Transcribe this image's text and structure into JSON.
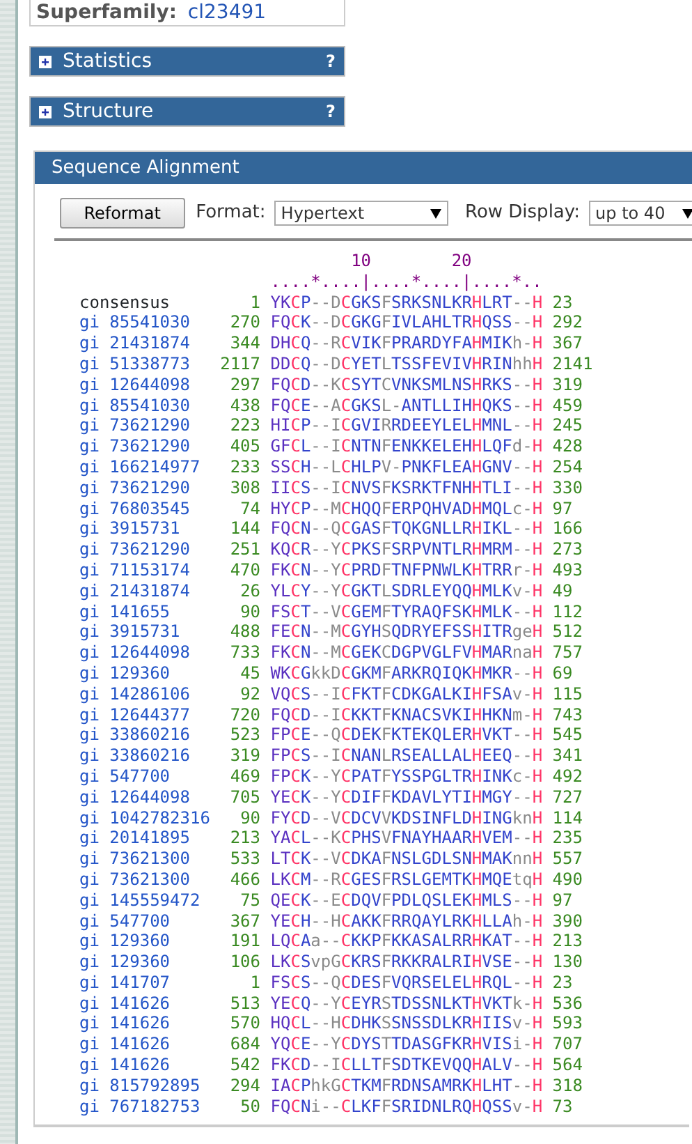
{
  "superfamily": {
    "label": "Superfamily:",
    "value": "cl23491"
  },
  "sections": [
    {
      "title": "Statistics",
      "expanded": false,
      "help": "?"
    },
    {
      "title": "Structure",
      "expanded": false,
      "help": "?"
    }
  ],
  "alignment_panel": {
    "title": "Sequence Alignment",
    "reformat_button": "Reformat",
    "format": {
      "label": "Format:",
      "value": "Hypertext"
    },
    "row_display": {
      "label": "Row Display:",
      "value": "up to 40"
    },
    "ruler": {
      "ticks": [
        "10",
        "20"
      ],
      "scale": "....*....|....*....|....*.."
    },
    "rows": [
      {
        "kind": "consensus",
        "name": "consensus",
        "start": "1",
        "sequence": "YKCP--DCGKSFSRKSNLKRHLRT--H",
        "end": "23"
      },
      {
        "kind": "hit",
        "name": "gi 85541030",
        "start": "270",
        "sequence": "FQCK--DCGKGFIVLAHLTRHQSS--H",
        "end": "292"
      },
      {
        "kind": "hit",
        "name": "gi 21431874",
        "start": "344",
        "sequence": "DHCQ--RCVIKFPRARDYFAHMIKh-H",
        "end": "367"
      },
      {
        "kind": "hit",
        "name": "gi 51338773",
        "start": "2117",
        "sequence": "DDCQ--DCYETLTSSFEVIVHRINhhH",
        "end": "2141"
      },
      {
        "kind": "hit",
        "name": "gi 12644098",
        "start": "297",
        "sequence": "FQCD--KCSYTCVNKSMLNSHRKS--H",
        "end": "319"
      },
      {
        "kind": "hit",
        "name": "gi 85541030",
        "start": "438",
        "sequence": "FQCE--ACGKSL-ANTLLIHHQKS--H",
        "end": "459"
      },
      {
        "kind": "hit",
        "name": "gi 73621290",
        "start": "223",
        "sequence": "HICP--ICGVIRRDEEYLELHMNL--H",
        "end": "245"
      },
      {
        "kind": "hit",
        "name": "gi 73621290",
        "start": "405",
        "sequence": "GFCL--ICNTNFENKKELEHHLQFd-H",
        "end": "428"
      },
      {
        "kind": "hit",
        "name": "gi 166214977",
        "start": "233",
        "sequence": "SSCH--LCHLPV-PNKFLEAHGNV--H",
        "end": "254"
      },
      {
        "kind": "hit",
        "name": "gi 73621290",
        "start": "308",
        "sequence": "IICS--ICNVSFKSRKTFNHHTLI--H",
        "end": "330"
      },
      {
        "kind": "hit",
        "name": "gi 76803545",
        "start": "74",
        "sequence": "HYCP--MCHQQFERPQHVADHMQLc-H",
        "end": "97"
      },
      {
        "kind": "hit",
        "name": "gi 3915731",
        "start": "144",
        "sequence": "FQCN--QCGASFTQKGNLLRHIKL--H",
        "end": "166"
      },
      {
        "kind": "hit",
        "name": "gi 73621290",
        "start": "251",
        "sequence": "KQCR--YCPKSFSRPVNTLRHMRM--H",
        "end": "273"
      },
      {
        "kind": "hit",
        "name": "gi 71153174",
        "start": "470",
        "sequence": "FKCN--YCPRDFTNFPNWLKHTRRr-H",
        "end": "493"
      },
      {
        "kind": "hit",
        "name": "gi 21431874",
        "start": "26",
        "sequence": "YLCY--YCGKTLSDRLEYQQHMLKv-H",
        "end": "49"
      },
      {
        "kind": "hit",
        "name": "gi 141655",
        "start": "90",
        "sequence": "FSCT--VCGEMFTYRAQFSKHMLK--H",
        "end": "112"
      },
      {
        "kind": "hit",
        "name": "gi 3915731",
        "start": "488",
        "sequence": "FECN--MCGYHSQDRYEFSSHITRgeH",
        "end": "512"
      },
      {
        "kind": "hit",
        "name": "gi 12644098",
        "start": "733",
        "sequence": "FKCN--MCGEKCDGPVGLFVHMARnaH",
        "end": "757"
      },
      {
        "kind": "hit",
        "name": "gi 129360",
        "start": "45",
        "sequence": "WKCGkkDCGKMFARKRQIQKHMKR--H",
        "end": "69"
      },
      {
        "kind": "hit",
        "name": "gi 14286106",
        "start": "92",
        "sequence": "VQCS--ICFKTFCDKGALKIHFSAv-H",
        "end": "115"
      },
      {
        "kind": "hit",
        "name": "gi 12644377",
        "start": "720",
        "sequence": "FQCD--ICKKTFKNACSVKIHHKNm-H",
        "end": "743"
      },
      {
        "kind": "hit",
        "name": "gi 33860216",
        "start": "523",
        "sequence": "FPCE--QCDEKFKTEKQLERHVKT--H",
        "end": "545"
      },
      {
        "kind": "hit",
        "name": "gi 33860216",
        "start": "319",
        "sequence": "FPCS--ICNANLRSEALLALHEEQ--H",
        "end": "341"
      },
      {
        "kind": "hit",
        "name": "gi 547700",
        "start": "469",
        "sequence": "FPCK--YCPATFYSSPGLTRHINKc-H",
        "end": "492"
      },
      {
        "kind": "hit",
        "name": "gi 12644098",
        "start": "705",
        "sequence": "YECK--YCDIFFKDAVLYTIHMGY--H",
        "end": "727"
      },
      {
        "kind": "hit",
        "name": "gi 1042782316",
        "start": "90",
        "sequence": "FYCD--VCDCVVKDSINFLDHINGknH",
        "end": "114"
      },
      {
        "kind": "hit",
        "name": "gi 20141895",
        "start": "213",
        "sequence": "YACL--KCPHSVFNAYHAARHVEM--H",
        "end": "235"
      },
      {
        "kind": "hit",
        "name": "gi 73621300",
        "start": "533",
        "sequence": "LTCK--VCDKAFNSLGDLSNHMAKnnH",
        "end": "557"
      },
      {
        "kind": "hit",
        "name": "gi 73621300",
        "start": "466",
        "sequence": "LKCM--RCGESFRSLGEMTKHMQEtqH",
        "end": "490"
      },
      {
        "kind": "hit",
        "name": "gi 145559472",
        "start": "75",
        "sequence": "QECK--ECDQVFPDLQSLEKHMLS--H",
        "end": "97"
      },
      {
        "kind": "hit",
        "name": "gi 547700",
        "start": "367",
        "sequence": "YECH--HCAKKFRRQAYLRKHLLAh-H",
        "end": "390"
      },
      {
        "kind": "hit",
        "name": "gi 129360",
        "start": "191",
        "sequence": "LQCAa--CKKPFKKASALRRHKAT--H",
        "end": "213"
      },
      {
        "kind": "hit",
        "name": "gi 129360",
        "start": "106",
        "sequence": "LKCSvpGCKRSFRKKRALRIHVSE--H",
        "end": "130"
      },
      {
        "kind": "hit",
        "name": "gi 141707",
        "start": "1",
        "sequence": "FSCS--QCDESFVQRSELELHRQL--H",
        "end": "23"
      },
      {
        "kind": "hit",
        "name": "gi 141626",
        "start": "513",
        "sequence": "YECQ--YCEYRSTDSSNLKTHVKTk-H",
        "end": "536"
      },
      {
        "kind": "hit",
        "name": "gi 141626",
        "start": "570",
        "sequence": "HQCL--HCDHKSSNSSDLKRHIISv-H",
        "end": "593"
      },
      {
        "kind": "hit",
        "name": "gi 141626",
        "start": "684",
        "sequence": "YQCE--YCDYSTTDASGFKRHVISi-H",
        "end": "707"
      },
      {
        "kind": "hit",
        "name": "gi 141626",
        "start": "542",
        "sequence": "FKCD--ICLLTFSDTKEVQQHALV--H",
        "end": "564"
      },
      {
        "kind": "hit",
        "name": "gi 815792895",
        "start": "294",
        "sequence": "IACPhkGCTKMFRDNSAMRKHLHT--H",
        "end": "318"
      },
      {
        "kind": "hit",
        "name": "gi 767182753",
        "start": "50",
        "sequence": "FQCNi--CLKFFSRIDNLRQHQSSv-H",
        "end": "73"
      }
    ]
  }
}
